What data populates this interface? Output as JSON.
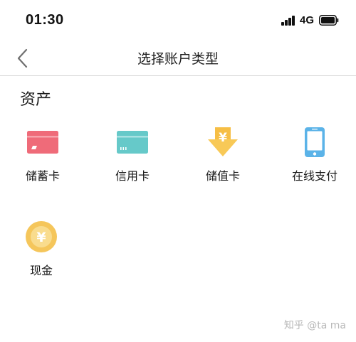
{
  "status_bar": {
    "time": "01:30",
    "network": "4G",
    "icons": [
      "signal-icon",
      "battery-icon"
    ]
  },
  "nav": {
    "title": "选择账户类型",
    "back_icon": "chevron-left-icon"
  },
  "section": {
    "title": "资产"
  },
  "items": [
    {
      "label": "储蓄卡",
      "icon": "debit-card-icon",
      "color": "#EF6B79"
    },
    {
      "label": "信用卡",
      "icon": "credit-card-icon",
      "color": "#66C9C9"
    },
    {
      "label": "储值卡",
      "icon": "stored-value-icon",
      "color": "#F8C957"
    },
    {
      "label": "在线支付",
      "icon": "phone-icon",
      "color": "#5BB3E8"
    },
    {
      "label": "现金",
      "icon": "cash-coin-icon",
      "color": "#F5C65B"
    }
  ],
  "icon_glyphs": {
    "yuan": "¥"
  },
  "watermark": {
    "text": "知乎 @ta ma"
  }
}
